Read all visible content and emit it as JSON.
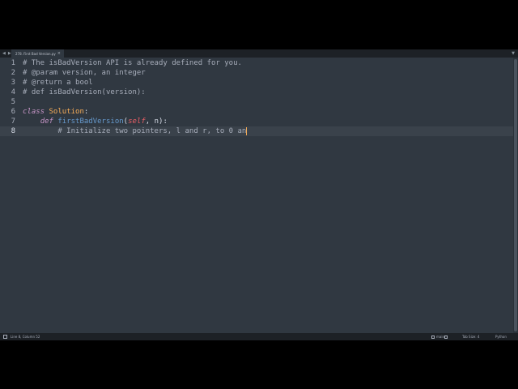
{
  "tab": {
    "filename": "278. First Bad Version.py",
    "close_glyph": "×"
  },
  "nav": {
    "back_glyph": "◀",
    "forward_glyph": "▶",
    "dropdown_glyph": "▼"
  },
  "editor": {
    "lines": [
      {
        "num": "1",
        "text": "# The isBadVersion API is already defined for you."
      },
      {
        "num": "2",
        "text": "# @param version, an integer"
      },
      {
        "num": "3",
        "text": "# @return a bool"
      },
      {
        "num": "4",
        "text": "# def isBadVersion(version):"
      },
      {
        "num": "5",
        "text": ""
      },
      {
        "num": "6",
        "text": "class Solution:"
      },
      {
        "num": "7",
        "text": "    def firstBadVersion(self, n):"
      },
      {
        "num": "8",
        "text": "        # Initialize two pointers, l and r, to 0 an"
      }
    ],
    "active_line": 8,
    "tokens": {
      "l6_kw": "class",
      "l6_cls": "Solution",
      "l6_colon": ":",
      "l7_kw": "def",
      "l7_fn": "firstBadVersion",
      "l7_open": "(",
      "l7_self": "self",
      "l7_rest": ", n):"
    }
  },
  "status": {
    "position": "Line 8, Column 52",
    "branch": "main",
    "tab_size": "Tab Size: 4",
    "syntax": "Python"
  },
  "colors": {
    "background": "#303841",
    "comment": "#a7adba",
    "keyword": "#c594c5",
    "class_name": "#f9ae58",
    "function": "#6699cc",
    "self": "#ec5f66"
  }
}
